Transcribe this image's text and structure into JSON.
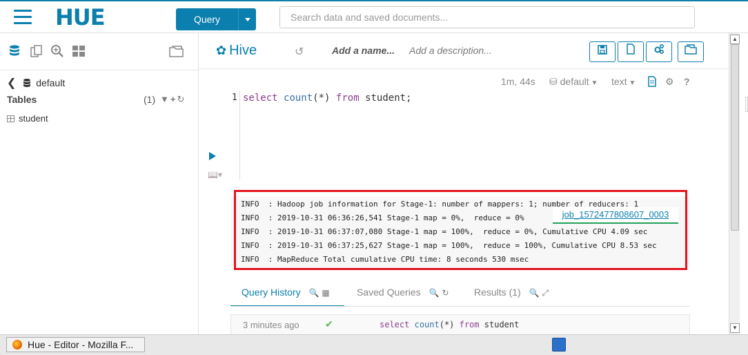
{
  "topbar": {
    "logo_text": "HUE",
    "query_button": "Query",
    "search_placeholder": "Search data and saved documents..."
  },
  "leftpanel": {
    "database": "default",
    "tables_label": "Tables",
    "tables_count": "(1)",
    "tables": [
      "student"
    ]
  },
  "editor": {
    "engine": "Hive",
    "name_placeholder": "Add a name...",
    "description_placeholder": "Add a description...",
    "elapsed": "1m, 44s",
    "db_select": "default",
    "format_select": "text",
    "line_number": "1",
    "code": {
      "kw1": "select",
      "fn": "count",
      "args": "(*)",
      "kw2": "from",
      "rest": "student;"
    }
  },
  "log": {
    "lines": [
      "INFO  : Hadoop job information for Stage-1: number of mappers: 1; number of reducers: 1",
      "INFO  : 2019-10-31 06:36:26,541 Stage-1 map = 0%,  reduce = 0%",
      "INFO  : 2019-10-31 06:37:07,080 Stage-1 map = 100%,  reduce = 0%, Cumulative CPU 4.09 sec",
      "INFO  : 2019-10-31 06:37:25,627 Stage-1 map = 100%,  reduce = 100%, Cumulative CPU 8.53 sec",
      "INFO  : MapReduce Total cumulative CPU time: 8 seconds 530 msec"
    ],
    "job_link": "job_1572477808607_0003",
    "highlight_color": "#e3121e"
  },
  "tabs": [
    {
      "label": "Query History",
      "active": true
    },
    {
      "label": "Saved Queries",
      "active": false
    },
    {
      "label": "Results (1)",
      "active": false
    }
  ],
  "history": {
    "time": "3 minutes ago",
    "code": {
      "kw1": "select",
      "fn": "count",
      "args": "(*)",
      "kw2": "from",
      "rest": "student"
    }
  },
  "taskbar": {
    "window_title": "Hue - Editor - Mozilla F..."
  },
  "colors": {
    "accent": "#0B7FAD",
    "success": "#5cb85c"
  }
}
